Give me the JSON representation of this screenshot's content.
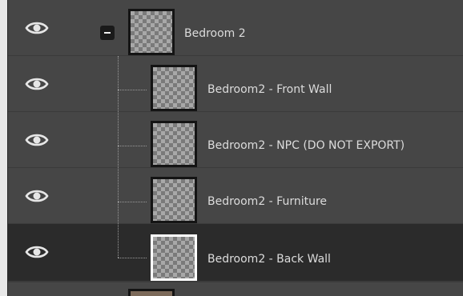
{
  "layers": [
    {
      "name": "Bedroom 2",
      "visible": true,
      "is_group": true,
      "expanded": true
    },
    {
      "name": "Bedroom2 - Front Wall",
      "visible": true,
      "is_group": false
    },
    {
      "name": "Bedroom2 - NPC (DO NOT EXPORT)",
      "visible": true,
      "is_group": false
    },
    {
      "name": "Bedroom2 - Furniture",
      "visible": true,
      "is_group": false
    },
    {
      "name": "Bedroom2 - Back Wall",
      "visible": true,
      "is_group": false,
      "selected": true
    }
  ],
  "icons": {
    "visibility": "eye-icon",
    "collapse": "minus-icon"
  },
  "colors": {
    "panel_bg": "#464646",
    "selected_bg": "#2b2b2b",
    "text": "#dcdcdc",
    "selected_thumb_border": "#ffffff"
  }
}
